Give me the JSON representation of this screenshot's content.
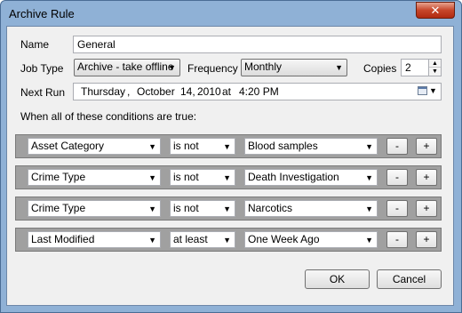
{
  "window": {
    "title": "Archive Rule",
    "close_glyph": "✕"
  },
  "form": {
    "name_label": "Name",
    "name_value": "General",
    "job_type_label": "Job Type",
    "job_type_value": "Archive - take offline",
    "frequency_label": "Frequency",
    "frequency_value": "Monthly",
    "copies_label": "Copies",
    "copies_value": "2",
    "next_run_label": "Next Run",
    "next_run": {
      "weekday": "Thursday",
      "sep1": ",",
      "month": "October",
      "day": "14,",
      "year": "2010",
      "at": "at",
      "time": "4:20 PM"
    },
    "conditions_label": "When all of these conditions are true:"
  },
  "conditions": [
    {
      "field": "Asset Category",
      "operator": "is not",
      "value": "Blood samples"
    },
    {
      "field": "Crime Type",
      "operator": "is not",
      "value": "Death Investigation"
    },
    {
      "field": "Crime Type",
      "operator": "is not",
      "value": "Narcotics"
    },
    {
      "field": "Last Modified",
      "operator": "at least",
      "value": "One Week Ago"
    }
  ],
  "row_buttons": {
    "remove": "-",
    "add": "+"
  },
  "buttons": {
    "ok": "OK",
    "cancel": "Cancel"
  },
  "icons": {
    "dropdown": "▼",
    "spin_up": "▲",
    "spin_down": "▼"
  }
}
